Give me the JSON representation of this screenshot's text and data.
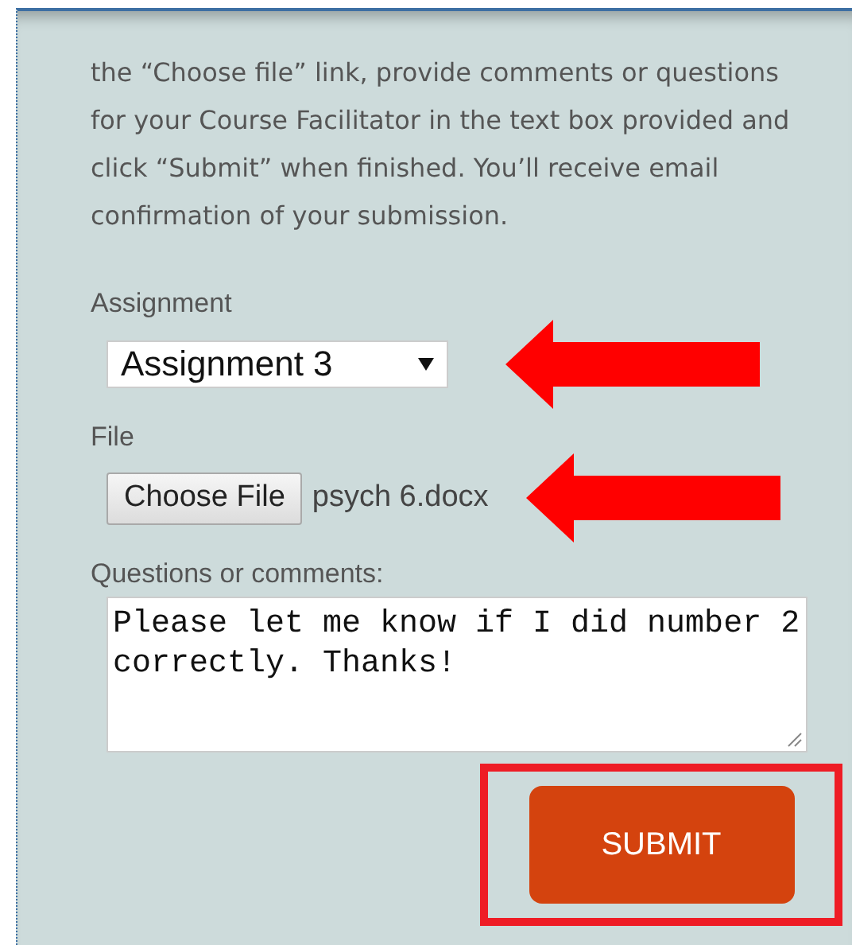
{
  "instructions": "the “Choose file” link, provide comments or questions for your Course Facilitator in the text box provided and click “Submit” when finished. You’ll receive email confirmation of your submission.",
  "assignment": {
    "label": "Assignment",
    "value": "Assignment 3"
  },
  "file": {
    "label": "File",
    "button": "Choose File",
    "filename": "psych 6.docx"
  },
  "comments": {
    "label": "Questions or comments:",
    "value": "Please let me know if I did number 2 correctly. Thanks!"
  },
  "submit": "SUBMIT"
}
